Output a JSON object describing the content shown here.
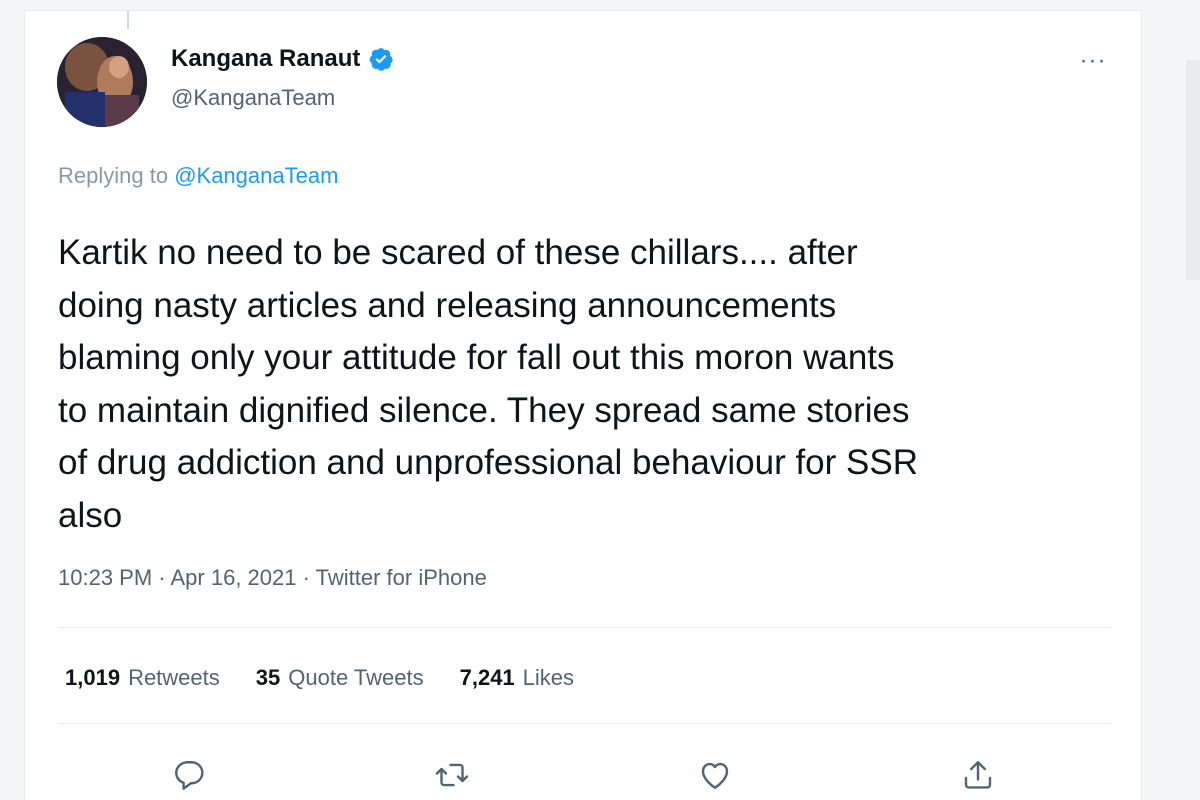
{
  "author": {
    "display_name": "Kangana Ranaut",
    "handle": "@KanganaTeam",
    "verified_icon": "verified-badge-icon",
    "avatar": "profile-avatar"
  },
  "header": {
    "more_icon": "more-options-icon",
    "more_label": "···"
  },
  "reply_context": {
    "prefix": "Replying to ",
    "mention": "@KanganaTeam"
  },
  "tweet": {
    "text": "Kartik no need to be scared of these chillars.... after\ndoing nasty articles and releasing announcements\nblaming only your attitude for fall out this moron wants\nto maintain dignified silence. They spread same stories\nof drug addiction and unprofessional behaviour for SSR\nalso",
    "timestamp": "10:23 PM · Apr 16, 2021 · Twitter for iPhone"
  },
  "stats": {
    "retweets_count": "1,019",
    "retweets_label": "Retweets",
    "quotes_count": "35",
    "quotes_label": "Quote Tweets",
    "likes_count": "7,241",
    "likes_label": "Likes"
  },
  "actions": [
    "reply-icon",
    "retweet-icon",
    "like-icon",
    "share-icon"
  ],
  "colors": {
    "accent": "#1d9bf0",
    "text_primary": "#0f1419",
    "text_secondary": "#536471",
    "divider": "#e6ecf0",
    "background": "#ffffff"
  }
}
